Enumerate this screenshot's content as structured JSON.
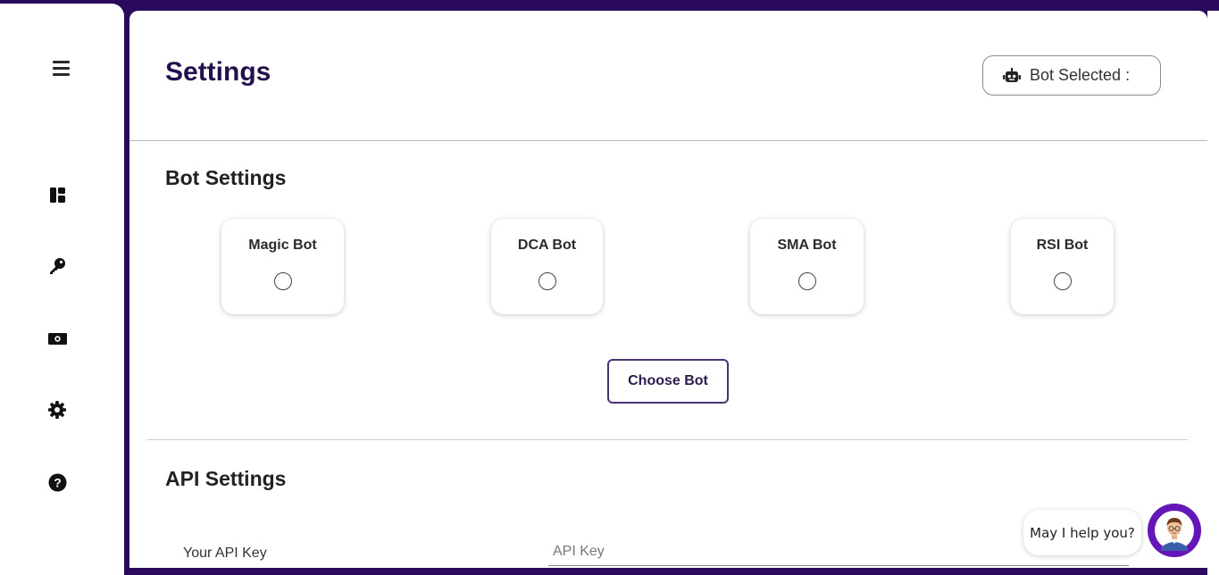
{
  "page": {
    "title": "Settings"
  },
  "header": {
    "bot_selected_label": "Bot Selected :"
  },
  "sidebar": {
    "menu_icon": "hamburger-menu-icon",
    "items": [
      {
        "icon": "dashboard-icon"
      },
      {
        "icon": "key-icon"
      },
      {
        "icon": "money-icon"
      },
      {
        "icon": "gear-icon"
      },
      {
        "icon": "help-circle-icon"
      }
    ]
  },
  "bot_settings": {
    "title": "Bot Settings",
    "bots": [
      {
        "name": "Magic Bot"
      },
      {
        "name": "DCA Bot"
      },
      {
        "name": "SMA Bot"
      },
      {
        "name": "RSI Bot"
      }
    ],
    "choose_button": "Choose Bot"
  },
  "api_settings": {
    "title": "API Settings",
    "api_key_label": "Your API Key",
    "api_key_placeholder": "API Key",
    "api_key_value": ""
  },
  "chat": {
    "bubble_text": "May I help you?"
  },
  "colors": {
    "brand_dark": "#2a0a5c",
    "title": "#24104f",
    "chat_avatar_bg": "#6416b8",
    "choose_border": "#4a3272"
  }
}
